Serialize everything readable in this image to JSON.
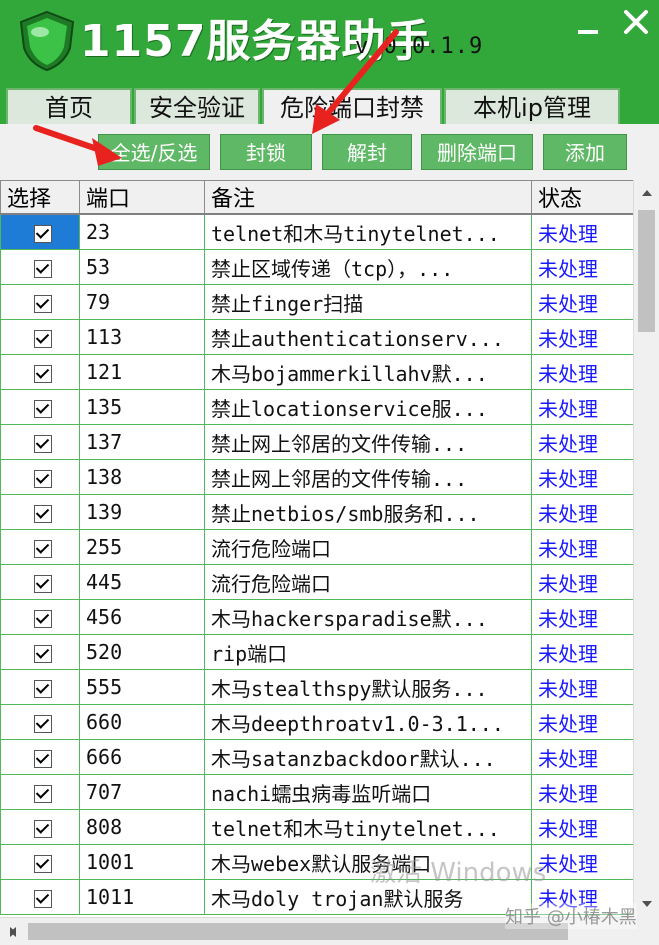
{
  "app": {
    "title": "1157服务器助手",
    "version": "v 0.0.1.9"
  },
  "colors": {
    "header_green": "#33a83a",
    "button_green": "#5fb865",
    "grid_line_green": "#4fb85a",
    "status_blue": "#1a1aff",
    "selection_blue": "#1e7bd6",
    "annotation_red": "#e8231f"
  },
  "tabs": [
    {
      "label": "首页",
      "active": false
    },
    {
      "label": "安全验证",
      "active": false
    },
    {
      "label": "危险端口封禁",
      "active": true
    },
    {
      "label": "本机ip管理",
      "active": false
    }
  ],
  "toolbar": {
    "select_all": "全选/反选",
    "block": "封锁",
    "unblock": "解封",
    "delete_port": "删除端口",
    "add": "添加"
  },
  "columns": {
    "select": "选择",
    "port": "端口",
    "note": "备注",
    "status": "状态"
  },
  "rows": [
    {
      "checked": true,
      "port": "23",
      "note": "telnet和木马tinytelnet...",
      "status": "未处理"
    },
    {
      "checked": true,
      "port": "53",
      "note": "禁止区域传递（tcp），...",
      "status": "未处理"
    },
    {
      "checked": true,
      "port": "79",
      "note": "禁止finger扫描",
      "status": "未处理"
    },
    {
      "checked": true,
      "port": "113",
      "note": "禁止authenticationserv...",
      "status": "未处理"
    },
    {
      "checked": true,
      "port": "121",
      "note": "木马bojammerkillahv默...",
      "status": "未处理"
    },
    {
      "checked": true,
      "port": "135",
      "note": "禁止locationservice服...",
      "status": "未处理"
    },
    {
      "checked": true,
      "port": "137",
      "note": "禁止网上邻居的文件传输...",
      "status": "未处理"
    },
    {
      "checked": true,
      "port": "138",
      "note": "禁止网上邻居的文件传输...",
      "status": "未处理"
    },
    {
      "checked": true,
      "port": "139",
      "note": "禁止netbios/smb服务和...",
      "status": "未处理"
    },
    {
      "checked": true,
      "port": "255",
      "note": "流行危险端口",
      "status": "未处理"
    },
    {
      "checked": true,
      "port": "445",
      "note": "流行危险端口",
      "status": "未处理"
    },
    {
      "checked": true,
      "port": "456",
      "note": "木马hackersparadise默...",
      "status": "未处理"
    },
    {
      "checked": true,
      "port": "520",
      "note": "rip端口",
      "status": "未处理"
    },
    {
      "checked": true,
      "port": "555",
      "note": "木马stealthspy默认服务...",
      "status": "未处理"
    },
    {
      "checked": true,
      "port": "660",
      "note": "木马deepthroatv1.0-3.1...",
      "status": "未处理"
    },
    {
      "checked": true,
      "port": "666",
      "note": "木马satanzbackdoor默认...",
      "status": "未处理"
    },
    {
      "checked": true,
      "port": "707",
      "note": "nachi蠕虫病毒监听端口",
      "status": "未处理"
    },
    {
      "checked": true,
      "port": "808",
      "note": "telnet和木马tinytelnet...",
      "status": "未处理"
    },
    {
      "checked": true,
      "port": "1001",
      "note": "木马webex默认服务端口",
      "status": "未处理"
    },
    {
      "checked": true,
      "port": "1011",
      "note": "木马doly trojan默认服务",
      "status": "未处理"
    }
  ],
  "watermark": {
    "windows": "激活 Windows",
    "zhihu": "知乎 @小椿木黑"
  }
}
